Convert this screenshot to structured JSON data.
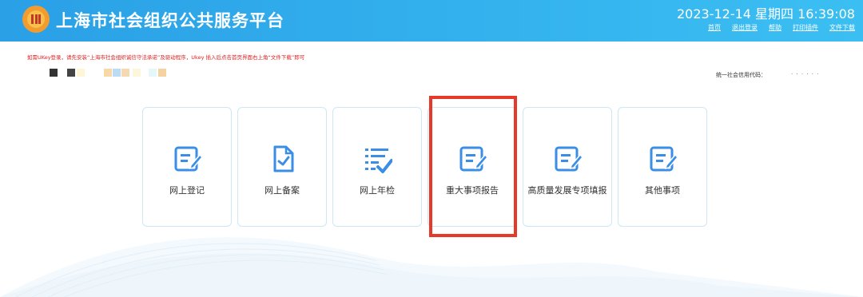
{
  "header": {
    "title": "上海市社会组织公共服务平台",
    "datetime": "2023-12-14 星期四 16:39:08",
    "links": [
      "首页",
      "退出登录",
      "帮助",
      "打印插件",
      "文件下载"
    ]
  },
  "notice": "如需UKey登录，请先安装“上海市社会组织诚信守法承诺”及驱动程序，Ukey 插入后点击首页界面右上角“文件下载”即可",
  "credit_code_label": "统一社会信用代码：",
  "credit_code_value": "· · · · · ·",
  "cards": [
    {
      "label": "网上登记",
      "icon": "edit-document-icon"
    },
    {
      "label": "网上备案",
      "icon": "file-check-icon"
    },
    {
      "label": "网上年检",
      "icon": "list-check-icon"
    },
    {
      "label": "重大事项报告",
      "icon": "edit-document-icon"
    },
    {
      "label": "高质量发展专项填报",
      "icon": "edit-document-icon"
    },
    {
      "label": "其他事项",
      "icon": "edit-document-icon"
    }
  ],
  "colors": {
    "header_start": "#2aa0e6",
    "header_end": "#3bbff2",
    "icon_blue": "#3a8ee6",
    "highlight_red": "#e53a2a",
    "notice_red": "#e02020"
  }
}
